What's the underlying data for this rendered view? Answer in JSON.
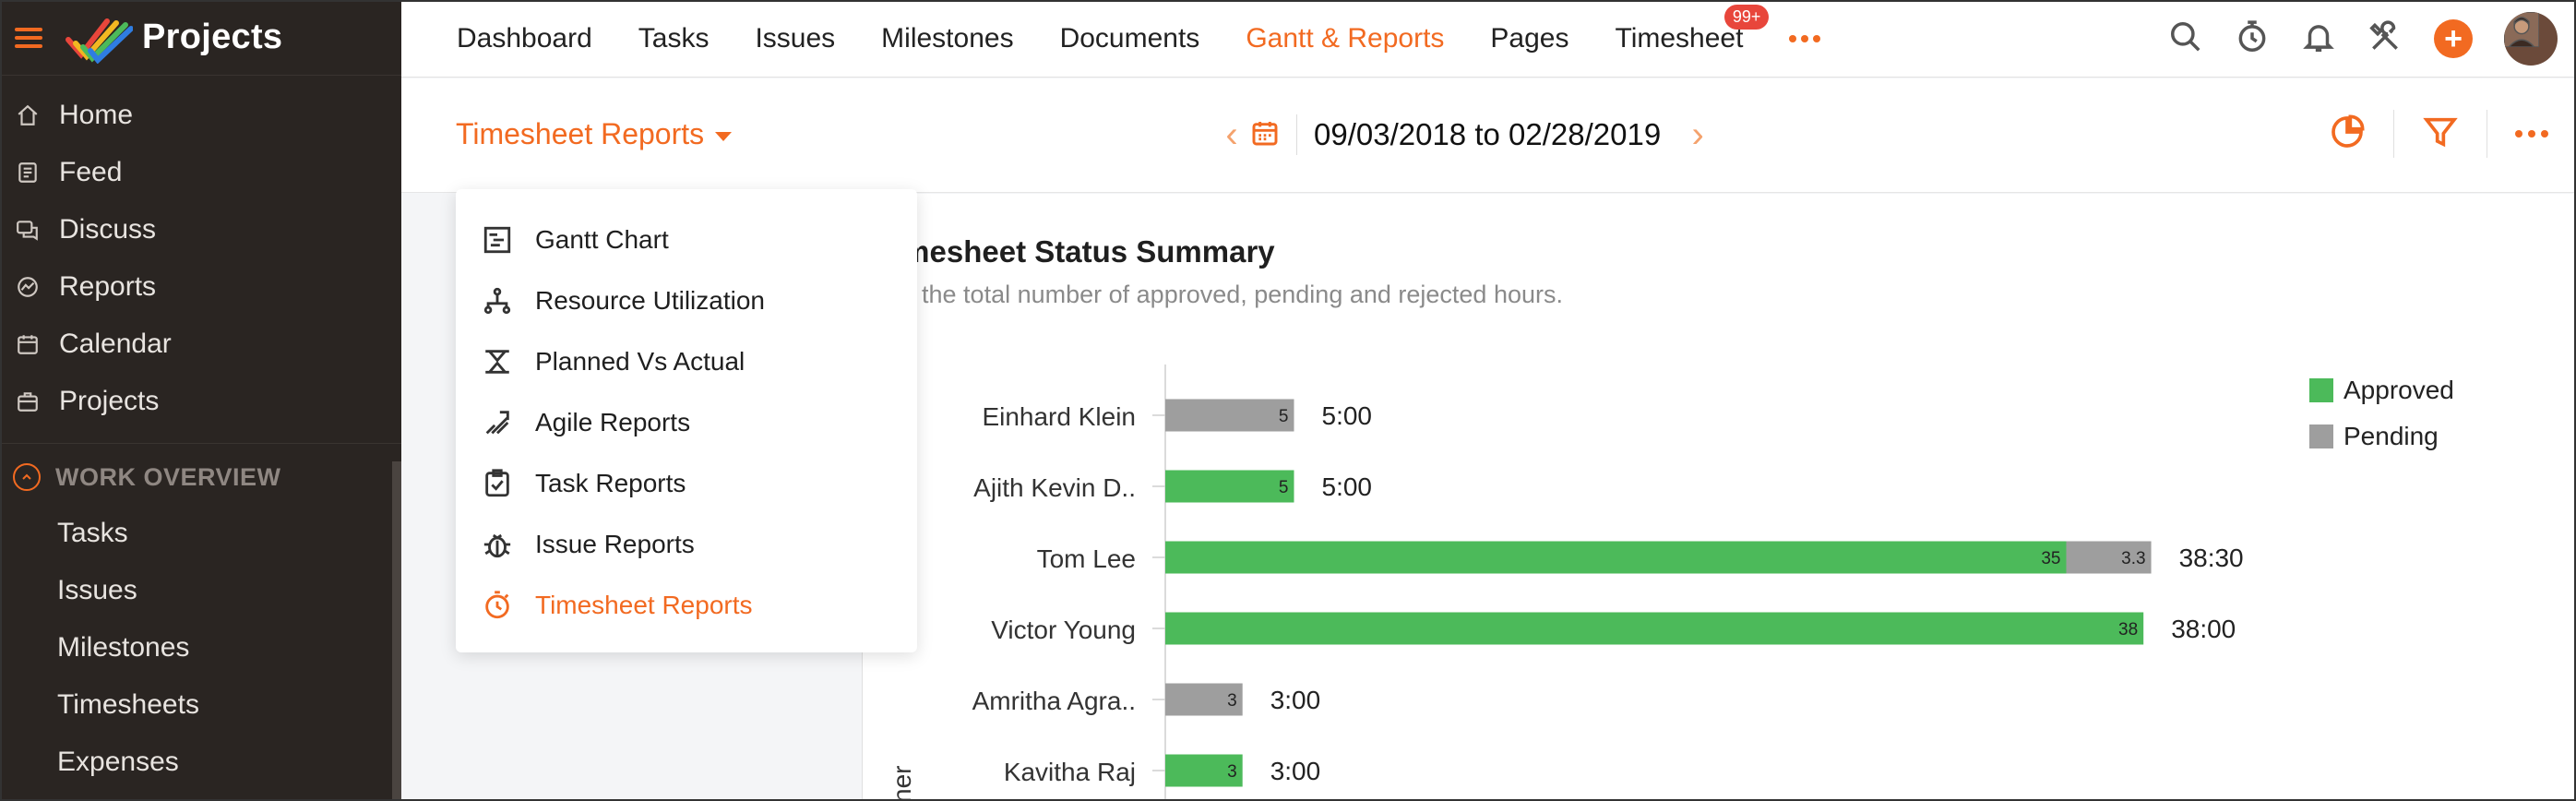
{
  "app": {
    "title": "Projects"
  },
  "sidebar": {
    "items": [
      {
        "label": "Home",
        "icon": "home-icon"
      },
      {
        "label": "Feed",
        "icon": "feed-icon"
      },
      {
        "label": "Discuss",
        "icon": "discuss-icon"
      },
      {
        "label": "Reports",
        "icon": "reports-icon"
      },
      {
        "label": "Calendar",
        "icon": "calendar-icon"
      },
      {
        "label": "Projects",
        "icon": "projects-icon"
      }
    ],
    "section_title": "WORK OVERVIEW",
    "section_items": [
      "Tasks",
      "Issues",
      "Milestones",
      "Timesheets",
      "Expenses"
    ]
  },
  "topnav": {
    "tabs": [
      "Dashboard",
      "Tasks",
      "Issues",
      "Milestones",
      "Documents",
      "Gantt & Reports",
      "Pages",
      "Timesheet"
    ],
    "active_tab": "Gantt & Reports",
    "timesheet_badge": "99+"
  },
  "subheader": {
    "report_selector": "Timesheet Reports",
    "date_range": "09/03/2018 to 02/28/2019"
  },
  "menu": {
    "items": [
      {
        "label": "Gantt Chart",
        "icon": "gantt-icon"
      },
      {
        "label": "Resource Utilization",
        "icon": "resource-icon"
      },
      {
        "label": "Planned Vs Actual",
        "icon": "planned-actual-icon"
      },
      {
        "label": "Agile Reports",
        "icon": "agile-icon"
      },
      {
        "label": "Task Reports",
        "icon": "task-report-icon"
      },
      {
        "label": "Issue Reports",
        "icon": "bug-icon"
      },
      {
        "label": "Timesheet Reports",
        "icon": "stopwatch-icon"
      }
    ],
    "active": "Timesheet Reports"
  },
  "chart": {
    "title": "imesheet Status Summary",
    "subtitle": "et the total number of approved, pending and rejected hours.",
    "axis_fragment": "ner"
  },
  "chart_data": {
    "type": "bar",
    "orientation": "horizontal",
    "stacked": true,
    "categories": [
      "Einhard Klein",
      "Ajith Kevin D..",
      "Tom Lee",
      "Victor Young",
      "Amritha Agra..",
      "Kavitha Raj"
    ],
    "series": [
      {
        "name": "Approved",
        "color": "#4cba5a",
        "values": [
          0,
          5,
          35,
          38,
          0,
          3
        ],
        "labels": [
          "",
          "5",
          "35",
          "38",
          "",
          "3"
        ]
      },
      {
        "name": "Pending",
        "color": "#9e9e9e",
        "values": [
          5,
          0,
          3.3,
          0,
          3,
          0
        ],
        "labels": [
          "5",
          "",
          "3.3",
          "",
          "3",
          ""
        ]
      }
    ],
    "totals": [
      "5:00",
      "5:00",
      "38:30",
      "38:00",
      "3:00",
      "3:00"
    ],
    "legend_position": "top-right"
  },
  "colors": {
    "accent": "#f26a21",
    "sidebar": "#2a2522",
    "approved": "#4cba5a",
    "pending": "#9e9e9e"
  }
}
